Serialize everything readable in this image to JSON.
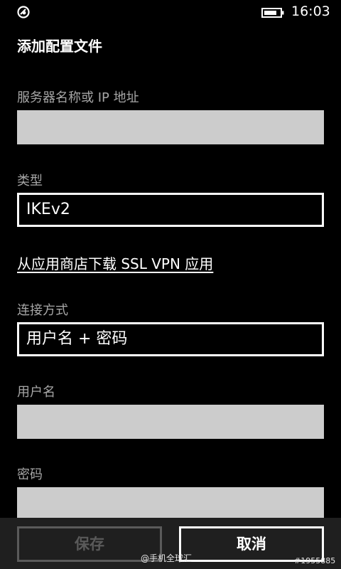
{
  "status_bar": {
    "time": "16:03",
    "left_icon": "vpn-shield-icon",
    "battery_icon": "battery-icon"
  },
  "header": {
    "title": "添加配置文件"
  },
  "form": {
    "server_label": "服务器名称或 IP 地址",
    "server_value": "",
    "type_label": "类型",
    "type_value": "IKEv2",
    "store_link": "从应用商店下载 SSL VPN 应用",
    "connect_label": "连接方式",
    "connect_value": "用户名 + 密码",
    "username_label": "用户名",
    "username_value": "",
    "password_label": "密码",
    "password_value": ""
  },
  "app_bar": {
    "save_label": "保存",
    "cancel_label": "取消"
  },
  "watermark": {
    "text": "@手机全球汇",
    "id": "#1955885"
  },
  "colors": {
    "background": "#000000",
    "label": "#a6a6a6",
    "textbox": "#cccccc",
    "appbar": "#1f1f1f",
    "disabled": "#5a5a5a"
  }
}
